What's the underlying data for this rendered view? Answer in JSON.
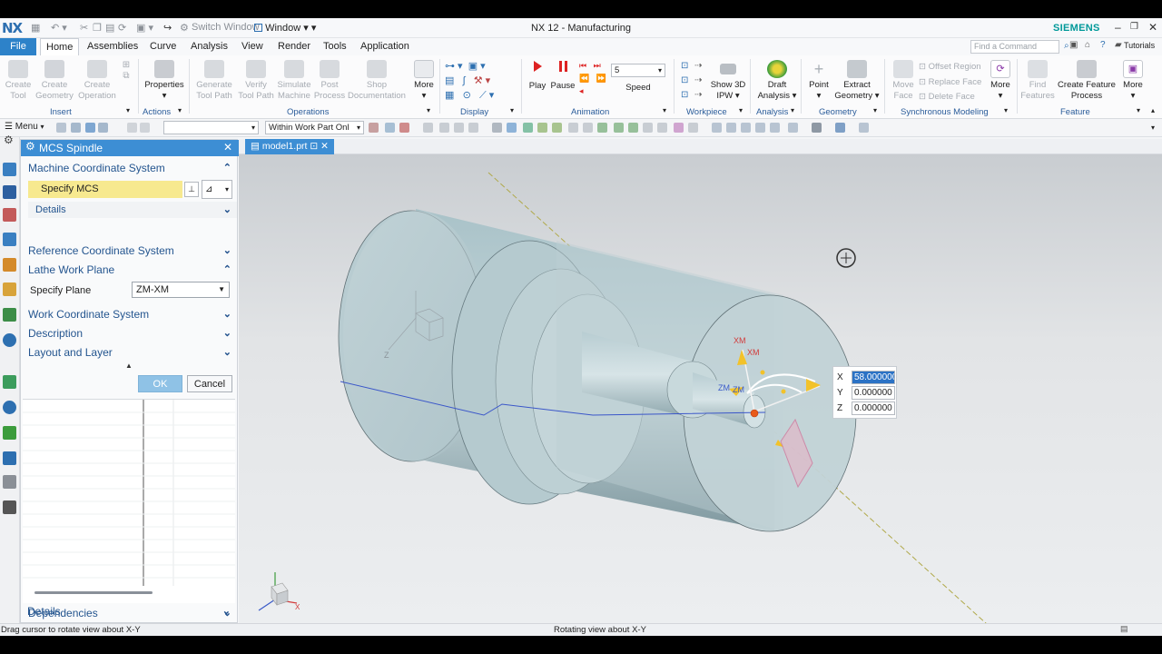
{
  "app": {
    "logo": "NX",
    "title": "NX 12 - Manufacturing",
    "brand": "SIEMENS",
    "switch_window": "Switch Window",
    "window_menu": "Window"
  },
  "colors": {
    "accent": "#2d82c9",
    "brand": "#009999",
    "highlight_yellow": "#f7e98f",
    "section_text": "#24558f"
  },
  "tabs": [
    {
      "label": "File"
    },
    {
      "label": "Home"
    },
    {
      "label": "Assemblies"
    },
    {
      "label": "Curve"
    },
    {
      "label": "Analysis"
    },
    {
      "label": "View"
    },
    {
      "label": "Render"
    },
    {
      "label": "Tools"
    },
    {
      "label": "Application"
    }
  ],
  "search": {
    "placeholder": "Find a Command"
  },
  "help": {
    "tutorials": "Tutorials"
  },
  "ribbon": {
    "groups": {
      "insert": "Insert",
      "actions": "Actions",
      "operations": "Operations",
      "display": "Display",
      "animation": "Animation",
      "workpiece": "Workpiece",
      "analysis": "Analysis",
      "geometry": "Geometry",
      "sync": "Synchronous Modeling",
      "feature": "Feature"
    },
    "buttons": {
      "create_tool_1": "Create",
      "create_tool_2": "Tool",
      "create_geom_1": "Create",
      "create_geom_2": "Geometry",
      "create_op_1": "Create",
      "create_op_2": "Operation",
      "properties": "Properties",
      "gen_path_1": "Generate",
      "gen_path_2": "Tool Path",
      "verify_1": "Verify",
      "verify_2": "Tool Path",
      "sim_1": "Simulate",
      "sim_2": "Machine",
      "post_1": "Post",
      "post_2": "Process",
      "shop_1": "Shop",
      "shop_2": "Documentation",
      "more_ops": "More",
      "play": "Play",
      "pause": "Pause",
      "speed_value": "5",
      "speed": "Speed",
      "show3d_1": "Show 3D",
      "show3d_2": "IPW",
      "draft_1": "Draft",
      "draft_2": "Analysis",
      "point": "Point",
      "extract_1": "Extract",
      "extract_2": "Geometry",
      "move_face_1": "Move",
      "move_face_2": "Face",
      "offset_region": "Offset Region",
      "replace_face": "Replace Face",
      "delete_face": "Delete Face",
      "more_sync": "More",
      "find_feat_1": "Find",
      "find_feat_2": "Features",
      "create_feat_1": "Create Feature",
      "create_feat_2": "Process",
      "more_feat": "More"
    }
  },
  "selection": {
    "menu": "Menu",
    "filter_value": "",
    "scope": "Within Work Part Onl"
  },
  "dialog": {
    "title": "MCS Spindle",
    "sections": {
      "mcs": "Machine Coordinate System",
      "specify_mcs": "Specify MCS",
      "details": "Details",
      "ref_cs": "Reference Coordinate System",
      "lathe_plane": "Lathe Work Plane",
      "specify_plane": "Specify Plane",
      "plane_value": "ZM-XM",
      "wcs": "Work Coordinate System",
      "description": "Description",
      "layout": "Layout and Layer",
      "dependencies": "Dependencies",
      "details2": "Details"
    },
    "ok": "OK",
    "cancel": "Cancel"
  },
  "graphics": {
    "file_tab": "model1.prt",
    "axis_labels": {
      "xm1": "XM",
      "xm2": "XM",
      "zm1": "ZM",
      "zm2": "ZM",
      "z": "Z",
      "triad_x": "X"
    },
    "coords": {
      "x_label": "X",
      "x_value": "58.000000",
      "y_label": "Y",
      "y_value": "0.000000",
      "z_label": "Z",
      "z_value": "0.000000"
    }
  },
  "status": {
    "left": "Drag cursor to rotate view about X-Y",
    "center": "Rotating view about X-Y"
  }
}
